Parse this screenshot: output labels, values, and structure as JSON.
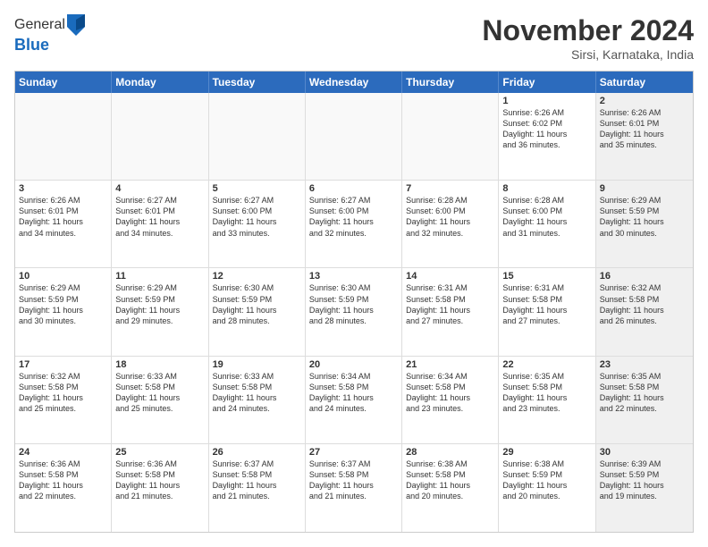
{
  "logo": {
    "general": "General",
    "blue": "Blue"
  },
  "title": "November 2024",
  "subtitle": "Sirsi, Karnataka, India",
  "headers": [
    "Sunday",
    "Monday",
    "Tuesday",
    "Wednesday",
    "Thursday",
    "Friday",
    "Saturday"
  ],
  "rows": [
    [
      {
        "day": "",
        "empty": true
      },
      {
        "day": "",
        "empty": true
      },
      {
        "day": "",
        "empty": true
      },
      {
        "day": "",
        "empty": true
      },
      {
        "day": "",
        "empty": true
      },
      {
        "day": "1",
        "info": "Sunrise: 6:26 AM\nSunset: 6:02 PM\nDaylight: 11 hours\nand 36 minutes.",
        "shaded": false
      },
      {
        "day": "2",
        "info": "Sunrise: 6:26 AM\nSunset: 6:01 PM\nDaylight: 11 hours\nand 35 minutes.",
        "shaded": true
      }
    ],
    [
      {
        "day": "3",
        "info": "Sunrise: 6:26 AM\nSunset: 6:01 PM\nDaylight: 11 hours\nand 34 minutes.",
        "shaded": false
      },
      {
        "day": "4",
        "info": "Sunrise: 6:27 AM\nSunset: 6:01 PM\nDaylight: 11 hours\nand 34 minutes.",
        "shaded": false
      },
      {
        "day": "5",
        "info": "Sunrise: 6:27 AM\nSunset: 6:00 PM\nDaylight: 11 hours\nand 33 minutes.",
        "shaded": false
      },
      {
        "day": "6",
        "info": "Sunrise: 6:27 AM\nSunset: 6:00 PM\nDaylight: 11 hours\nand 32 minutes.",
        "shaded": false
      },
      {
        "day": "7",
        "info": "Sunrise: 6:28 AM\nSunset: 6:00 PM\nDaylight: 11 hours\nand 32 minutes.",
        "shaded": false
      },
      {
        "day": "8",
        "info": "Sunrise: 6:28 AM\nSunset: 6:00 PM\nDaylight: 11 hours\nand 31 minutes.",
        "shaded": false
      },
      {
        "day": "9",
        "info": "Sunrise: 6:29 AM\nSunset: 5:59 PM\nDaylight: 11 hours\nand 30 minutes.",
        "shaded": true
      }
    ],
    [
      {
        "day": "10",
        "info": "Sunrise: 6:29 AM\nSunset: 5:59 PM\nDaylight: 11 hours\nand 30 minutes.",
        "shaded": false
      },
      {
        "day": "11",
        "info": "Sunrise: 6:29 AM\nSunset: 5:59 PM\nDaylight: 11 hours\nand 29 minutes.",
        "shaded": false
      },
      {
        "day": "12",
        "info": "Sunrise: 6:30 AM\nSunset: 5:59 PM\nDaylight: 11 hours\nand 28 minutes.",
        "shaded": false
      },
      {
        "day": "13",
        "info": "Sunrise: 6:30 AM\nSunset: 5:59 PM\nDaylight: 11 hours\nand 28 minutes.",
        "shaded": false
      },
      {
        "day": "14",
        "info": "Sunrise: 6:31 AM\nSunset: 5:58 PM\nDaylight: 11 hours\nand 27 minutes.",
        "shaded": false
      },
      {
        "day": "15",
        "info": "Sunrise: 6:31 AM\nSunset: 5:58 PM\nDaylight: 11 hours\nand 27 minutes.",
        "shaded": false
      },
      {
        "day": "16",
        "info": "Sunrise: 6:32 AM\nSunset: 5:58 PM\nDaylight: 11 hours\nand 26 minutes.",
        "shaded": true
      }
    ],
    [
      {
        "day": "17",
        "info": "Sunrise: 6:32 AM\nSunset: 5:58 PM\nDaylight: 11 hours\nand 25 minutes.",
        "shaded": false
      },
      {
        "day": "18",
        "info": "Sunrise: 6:33 AM\nSunset: 5:58 PM\nDaylight: 11 hours\nand 25 minutes.",
        "shaded": false
      },
      {
        "day": "19",
        "info": "Sunrise: 6:33 AM\nSunset: 5:58 PM\nDaylight: 11 hours\nand 24 minutes.",
        "shaded": false
      },
      {
        "day": "20",
        "info": "Sunrise: 6:34 AM\nSunset: 5:58 PM\nDaylight: 11 hours\nand 24 minutes.",
        "shaded": false
      },
      {
        "day": "21",
        "info": "Sunrise: 6:34 AM\nSunset: 5:58 PM\nDaylight: 11 hours\nand 23 minutes.",
        "shaded": false
      },
      {
        "day": "22",
        "info": "Sunrise: 6:35 AM\nSunset: 5:58 PM\nDaylight: 11 hours\nand 23 minutes.",
        "shaded": false
      },
      {
        "day": "23",
        "info": "Sunrise: 6:35 AM\nSunset: 5:58 PM\nDaylight: 11 hours\nand 22 minutes.",
        "shaded": true
      }
    ],
    [
      {
        "day": "24",
        "info": "Sunrise: 6:36 AM\nSunset: 5:58 PM\nDaylight: 11 hours\nand 22 minutes.",
        "shaded": false
      },
      {
        "day": "25",
        "info": "Sunrise: 6:36 AM\nSunset: 5:58 PM\nDaylight: 11 hours\nand 21 minutes.",
        "shaded": false
      },
      {
        "day": "26",
        "info": "Sunrise: 6:37 AM\nSunset: 5:58 PM\nDaylight: 11 hours\nand 21 minutes.",
        "shaded": false
      },
      {
        "day": "27",
        "info": "Sunrise: 6:37 AM\nSunset: 5:58 PM\nDaylight: 11 hours\nand 21 minutes.",
        "shaded": false
      },
      {
        "day": "28",
        "info": "Sunrise: 6:38 AM\nSunset: 5:58 PM\nDaylight: 11 hours\nand 20 minutes.",
        "shaded": false
      },
      {
        "day": "29",
        "info": "Sunrise: 6:38 AM\nSunset: 5:59 PM\nDaylight: 11 hours\nand 20 minutes.",
        "shaded": false
      },
      {
        "day": "30",
        "info": "Sunrise: 6:39 AM\nSunset: 5:59 PM\nDaylight: 11 hours\nand 19 minutes.",
        "shaded": true
      }
    ]
  ]
}
